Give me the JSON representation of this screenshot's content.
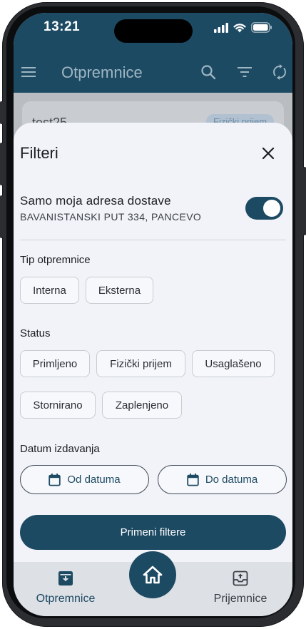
{
  "status_bar": {
    "time": "13:21"
  },
  "toolbar": {
    "title": "Otpremnice"
  },
  "background_list": {
    "first_item_name": "test25",
    "first_item_badge": "Fizički prijem"
  },
  "filters": {
    "title": "Filteri",
    "my_address": {
      "label": "Samo moja adresa dostave",
      "address": "BAVANISTANSKI PUT 334, PANCEVO",
      "enabled": true
    },
    "type_section": {
      "label": "Tip otpremnice",
      "options": [
        "Interna",
        "Eksterna"
      ]
    },
    "status_section": {
      "label": "Status",
      "options": [
        "Primljeno",
        "Fizički prijem",
        "Usaglašeno",
        "Stornirano",
        "Zaplenjeno"
      ]
    },
    "date_section": {
      "label": "Datum izdavanja",
      "from_label": "Od datuma",
      "to_label": "Do datuma"
    },
    "apply_label": "Primeni filtere"
  },
  "bottom_nav": {
    "items": [
      {
        "label": "Otpremnice",
        "active": true
      },
      {
        "label": "Prijemnice",
        "active": false
      }
    ]
  },
  "colors": {
    "primary": "#1d4a63",
    "active_nav": "#1d4a63",
    "inactive_nav": "#3a3e45"
  }
}
